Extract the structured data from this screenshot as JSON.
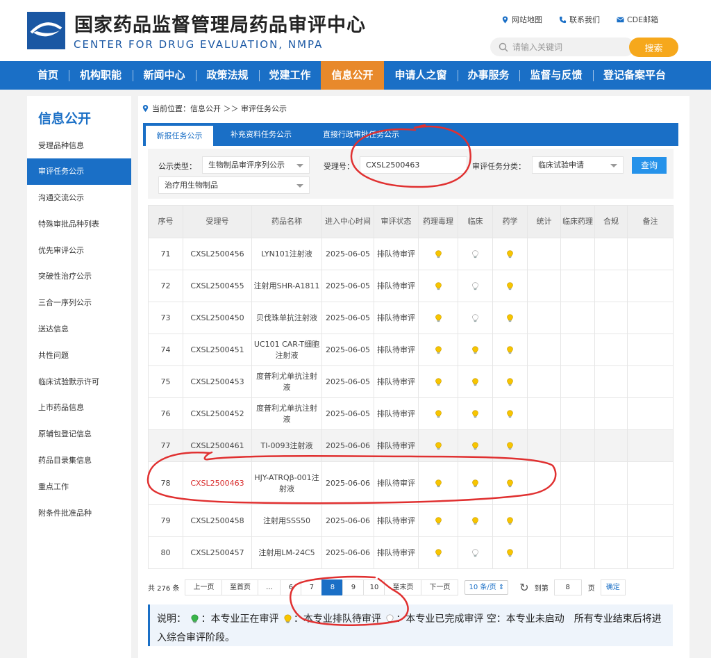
{
  "header": {
    "title": "国家药品监督管理局药品审评中心",
    "subtitle": "CENTER FOR DRUG EVALUATION, NMPA",
    "links": [
      "网站地图",
      "联系我们",
      "CDE邮箱"
    ],
    "search_placeholder": "请输入关键词",
    "search_button": "搜索"
  },
  "nav": {
    "items": [
      "首页",
      "机构职能",
      "新闻中心",
      "政策法规",
      "党建工作",
      "信息公开",
      "申请人之窗",
      "办事服务",
      "监督与反馈",
      "登记备案平台"
    ],
    "active": "信息公开"
  },
  "sidebar": {
    "title": "信息公开",
    "items": [
      "受理品种信息",
      "审评任务公示",
      "沟通交流公示",
      "特殊审批品种列表",
      "优先审评公示",
      "突破性治疗公示",
      "三合一序列公示",
      "送达信息",
      "共性问题",
      "临床试验默示许可",
      "上市药品信息",
      "原辅包登记信息",
      "药品目录集信息",
      "重点工作",
      "附条件批准品种"
    ],
    "active": "审评任务公示"
  },
  "breadcrumb": "当前位置：信息公开 ＞＞ 审评任务公示",
  "tabs": [
    "新报任务公示",
    "补充资料任务公示",
    "直接行政审批任务公示"
  ],
  "filters": {
    "type_label": "公示类型：",
    "type_value": "生物制品审评序列公示",
    "accept_label": "受理号：",
    "accept_value": "CXSL2500463",
    "category_label": "审评任务分类：",
    "category_value": "临床试验申请",
    "subtype_value": "治疗用生物制品",
    "query_button": "查询"
  },
  "table": {
    "headers": [
      "序号",
      "受理号",
      "药品名称",
      "进入中心时间",
      "审评状态",
      "药理毒理",
      "临床",
      "药学",
      "统计",
      "临床药理",
      "合规",
      "备注"
    ],
    "rows": [
      {
        "no": "71",
        "acc": "CXSL2500456",
        "name": "LYN101注射液",
        "date": "2025-06-05",
        "status": "排队待审评",
        "icons": [
          "yellow",
          "white",
          "yellow",
          "",
          "",
          "",
          ""
        ]
      },
      {
        "no": "72",
        "acc": "CXSL2500455",
        "name": "注射用SHR-A1811",
        "date": "2025-06-05",
        "status": "排队待审评",
        "icons": [
          "yellow",
          "white",
          "yellow",
          "",
          "",
          "",
          ""
        ]
      },
      {
        "no": "73",
        "acc": "CXSL2500450",
        "name": "贝伐珠单抗注射液",
        "date": "2025-06-05",
        "status": "排队待审评",
        "icons": [
          "yellow",
          "white",
          "yellow",
          "",
          "",
          "",
          ""
        ]
      },
      {
        "no": "74",
        "acc": "CXSL2500451",
        "name": "UC101 CAR-T细胞注射液",
        "date": "2025-06-05",
        "status": "排队待审评",
        "icons": [
          "yellow",
          "yellow",
          "yellow",
          "",
          "",
          "",
          ""
        ]
      },
      {
        "no": "75",
        "acc": "CXSL2500453",
        "name": "度普利尤单抗注射液",
        "date": "2025-06-05",
        "status": "排队待审评",
        "icons": [
          "yellow",
          "yellow",
          "yellow",
          "",
          "",
          "",
          ""
        ]
      },
      {
        "no": "76",
        "acc": "CXSL2500452",
        "name": "度普利尤单抗注射液",
        "date": "2025-06-05",
        "status": "排队待审评",
        "icons": [
          "yellow",
          "yellow",
          "yellow",
          "",
          "",
          "",
          ""
        ]
      },
      {
        "no": "77",
        "acc": "CXSL2500461",
        "name": "TI-0093注射液",
        "date": "2025-06-06",
        "status": "排队待审评",
        "icons": [
          "yellow",
          "yellow",
          "yellow",
          "",
          "",
          "",
          ""
        ]
      },
      {
        "no": "78",
        "acc": "CXSL2500463",
        "name": "HJY-ATRQβ-001注射液",
        "date": "2025-06-06",
        "status": "排队待审评",
        "icons": [
          "yellow",
          "yellow",
          "yellow",
          "",
          "",
          "",
          ""
        ]
      },
      {
        "no": "79",
        "acc": "CXSL2500458",
        "name": "注射用SSS50",
        "date": "2025-06-06",
        "status": "排队待审评",
        "icons": [
          "yellow",
          "yellow",
          "yellow",
          "",
          "",
          "",
          ""
        ]
      },
      {
        "no": "80",
        "acc": "CXSL2500457",
        "name": "注射用LM-24C5",
        "date": "2025-06-06",
        "status": "排队待审评",
        "icons": [
          "yellow",
          "white",
          "yellow",
          "",
          "",
          "",
          ""
        ]
      }
    ]
  },
  "pager": {
    "total": "共 276 条",
    "prev": "上一页",
    "first": "至首页",
    "ellipsis": "...",
    "pages": [
      "6",
      "7",
      "8",
      "9",
      "10"
    ],
    "current": "8",
    "last": "至末页",
    "next": "下一页",
    "size": "10 条/页",
    "goto_label": "到第",
    "goto_value": "8",
    "page_unit": "页",
    "confirm": "确定"
  },
  "legend": {
    "intro": "说明：",
    "green": "：本专业正在审评",
    "yellow": "：本专业排队待审评",
    "white": "：本专业已完成审评",
    "rest": "空：本专业未启动　所有专业结束后将进入综合审评阶段。"
  },
  "colors": {
    "primary": "#1a6fc6",
    "nav_active": "#e8892b",
    "search_button": "#f6a81c",
    "highlight_text": "#d82c2c",
    "annotation": "#e03030"
  }
}
